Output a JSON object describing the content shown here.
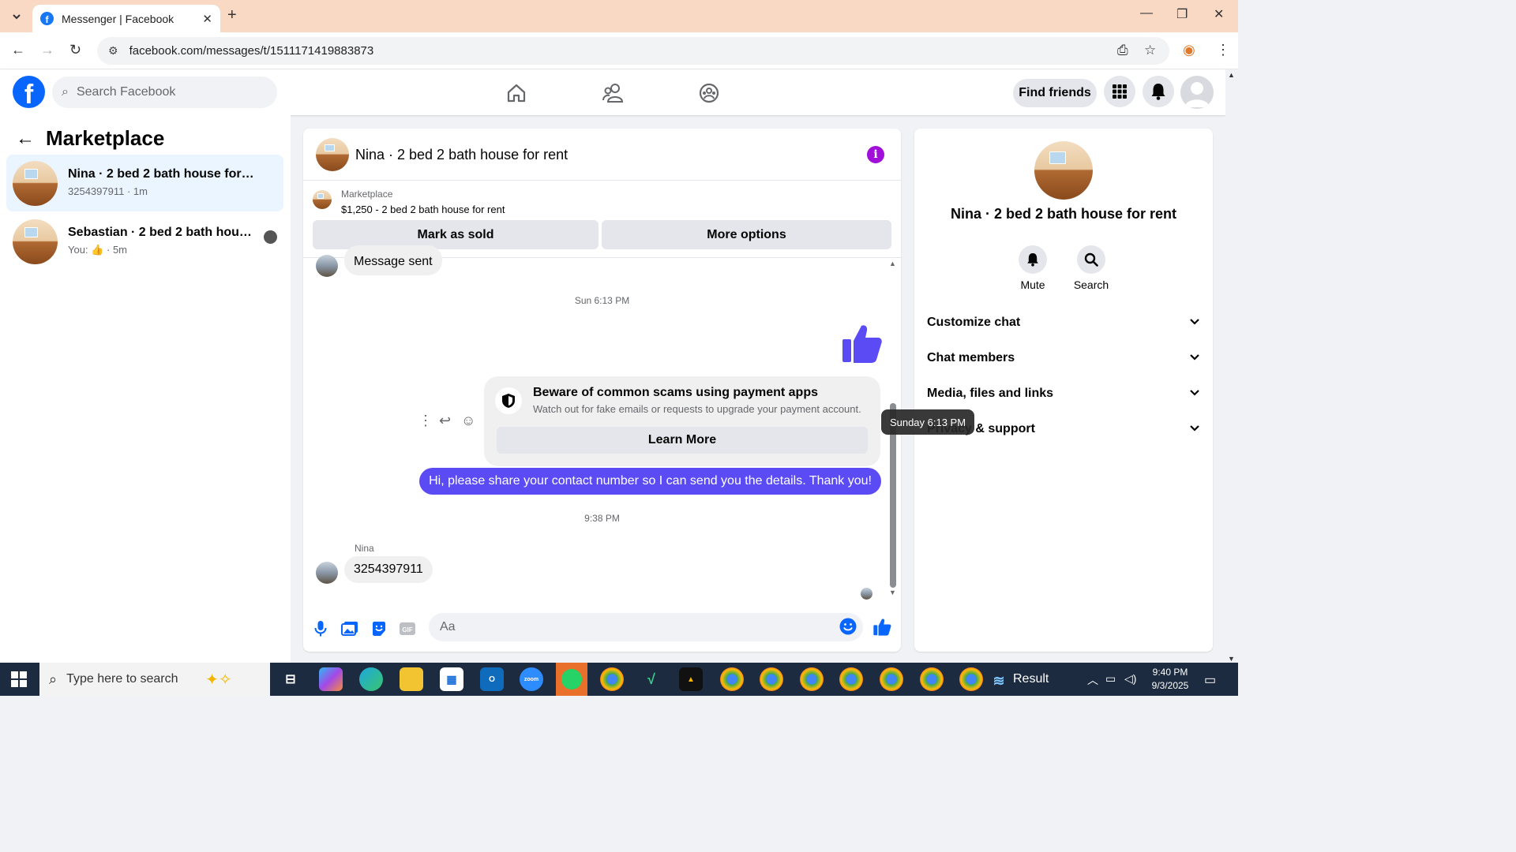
{
  "browser": {
    "tab_title": "Messenger | Facebook",
    "url": "facebook.com/messages/t/1511171419883873"
  },
  "fb": {
    "search_placeholder": "Search Facebook",
    "find_friends": "Find friends"
  },
  "sidebar": {
    "title": "Marketplace",
    "conversations": [
      {
        "name": "Nina · 2 bed 2 bath house for rent",
        "sub": "3254397911 · 1m",
        "active": true
      },
      {
        "name": "Sebastian · 2 bed 2 bath house f...",
        "sub_prefix": "You:",
        "sub_suffix": "· 5m",
        "active": false
      }
    ]
  },
  "chat": {
    "title": "Nina · 2 bed 2 bath house for rent",
    "listing": {
      "category": "Marketplace",
      "price_title": "$1,250 - 2 bed 2 bath house for rent",
      "mark_sold": "Mark as sold",
      "more_options": "More options"
    },
    "messages": {
      "first_bubble": "Message sent",
      "timestamp_1": "Sun 6:13 PM",
      "scam_title": "Beware of common scams using payment apps",
      "scam_desc": "Watch out for fake emails or requests to upgrade your payment account.",
      "learn_more": "Learn More",
      "outgoing": "Hi, please share your contact number so I can send you the details. Thank you!",
      "timestamp_2": "9:38 PM",
      "sender_name": "Nina",
      "incoming": "3254397911"
    },
    "composer_placeholder": "Aa",
    "tooltip": "Sunday 6:13 PM"
  },
  "right_panel": {
    "name": "Nina · 2 bed 2 bath house for rent",
    "actions": [
      {
        "label": "Mute"
      },
      {
        "label": "Search"
      }
    ],
    "sections": [
      "Customize chat",
      "Chat members",
      "Media, files and links",
      "Privacy & support"
    ]
  },
  "taskbar": {
    "search_placeholder": "Type here to search",
    "result_label": "Result",
    "time": "9:40 PM",
    "date": "9/3/2025"
  },
  "colors": {
    "fb_blue": "#0866ff",
    "outgoing_bubble": "#5b4bf5",
    "info_icon": "#a010d8",
    "active_conv_bg": "#ebf5ff"
  }
}
